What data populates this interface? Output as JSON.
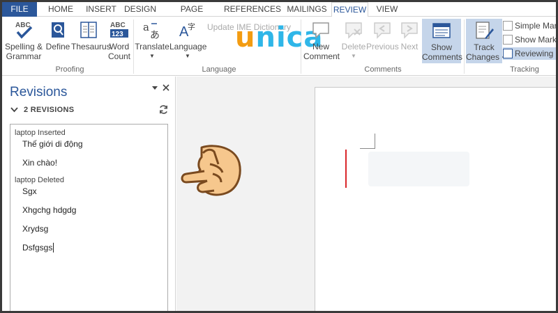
{
  "tabs": [
    {
      "label": "FILE"
    },
    {
      "label": "HOME"
    },
    {
      "label": "INSERT"
    },
    {
      "label": "DESIGN"
    },
    {
      "label": "PAGE LAYOUT"
    },
    {
      "label": "REFERENCES"
    },
    {
      "label": "MAILINGS"
    },
    {
      "label": "REVIEW"
    },
    {
      "label": "VIEW"
    }
  ],
  "ribbon": {
    "proofing": {
      "spelling": "Spelling &",
      "spelling2": "Grammar",
      "define": "Define",
      "thesaurus": "Thesaurus",
      "wordcount": "Word",
      "wordcount2": "Count",
      "group_label": "Proofing"
    },
    "language": {
      "translate": "Translate",
      "language": "Language",
      "update_ime": "Update IME Dictionary",
      "group_label": "Language"
    },
    "comments": {
      "new": "New",
      "new2": "Comment",
      "delete": "Delete",
      "previous": "Previous",
      "next": "Next",
      "show": "Show",
      "show2": "Comments",
      "group_label": "Comments"
    },
    "tracking": {
      "track": "Track",
      "track2": "Changes",
      "markup_mode": "Simple Markup",
      "show_markup": "Show Markup",
      "reviewing_pane": "Reviewing Pane",
      "group_label": "Tracking"
    }
  },
  "logo": {
    "first": "u",
    "rest": "nica"
  },
  "revisions": {
    "title": "Revisions",
    "count": "2 REVISIONS",
    "entries": [
      {
        "author": "laptop Inserted",
        "lines": [
          "Thế giới di động",
          "Xin chào!"
        ]
      },
      {
        "author": "laptop Deleted",
        "lines": [
          "Sgx",
          "Xhgchg  hdgdg",
          "Xrydsg",
          "Dsfgsgs"
        ]
      }
    ]
  },
  "icons": {
    "spelling": "abc-check-icon",
    "define": "magnifier-book-icon",
    "thesaurus": "book-icon",
    "wordcount": "abc-123-icon",
    "translate": "translate-icon",
    "language": "language-icon",
    "track_changes": "pencil-document-icon",
    "hand": "pointing-hand-icon"
  },
  "colors": {
    "accent": "#2b579a",
    "file_tab": "#2b579a",
    "deletion_bar": "#d9262b",
    "logo_orange": "#f39c12",
    "logo_blue": "#2fb6e8"
  }
}
